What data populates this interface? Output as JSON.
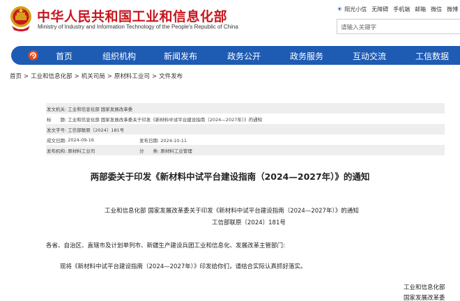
{
  "header": {
    "title": "中华人民共和国工业和信息化部",
    "subtitle": "Ministry of Industry and Information Technology of the People's Republic of China",
    "top_links": [
      "阳光小信",
      "无障碍",
      "手机端",
      "邮箱",
      "微信",
      "微博"
    ],
    "search_placeholder": "请输入关键字"
  },
  "nav": {
    "items": [
      "首页",
      "组织机构",
      "新闻发布",
      "政务公开",
      "政务服务",
      "互动交流",
      "工信数据"
    ]
  },
  "breadcrumb": [
    "首页",
    "工业和信息化部",
    "机关司局",
    "原材料工业司",
    "文件发布"
  ],
  "meta": {
    "issuer_label": "发文机关:",
    "issuer": "工业和信息化部 国家发展改革委",
    "subject_label": "标　　题:",
    "subject": "工业和信息化部 国家发展改革委关于印发《新材料中试平台建设指南（2024—2027年）》的通知",
    "doc_no_label": "发文字号:",
    "doc_no": "工信部联原〔2024〕181号",
    "created_label": "成文日期:",
    "created": "2024-09-16",
    "published_label": "发布日期:",
    "published": "2024-10-11",
    "dept_label": "发布机构:",
    "dept": "原材料工业司",
    "category_label": "分　　类:",
    "category": "原材料工业管理"
  },
  "article": {
    "title": "两部委关于印发《新材料中试平台建设指南（2024—2027年）》的通知",
    "notice_head": "工业和信息化部 国家发展改革委关于印发《新材料中试平台建设指南（2024—2027年）》的通知",
    "notice_no": "工信部联原〔2024〕181号",
    "addressee": "各省、自治区、直辖市及计划单列市、新疆生产建设兵团工业和信息化、发展改革主管部门:",
    "body": "现将《新材料中试平台建设指南（2024—2027年）》印发给你们，请结合实际认真抓好落实。",
    "sign1": "工业和信息化部",
    "sign2": "国家发展改革委"
  },
  "colors": {
    "brand_red": "#c8161d",
    "nav_blue": "#1e5bb3"
  }
}
